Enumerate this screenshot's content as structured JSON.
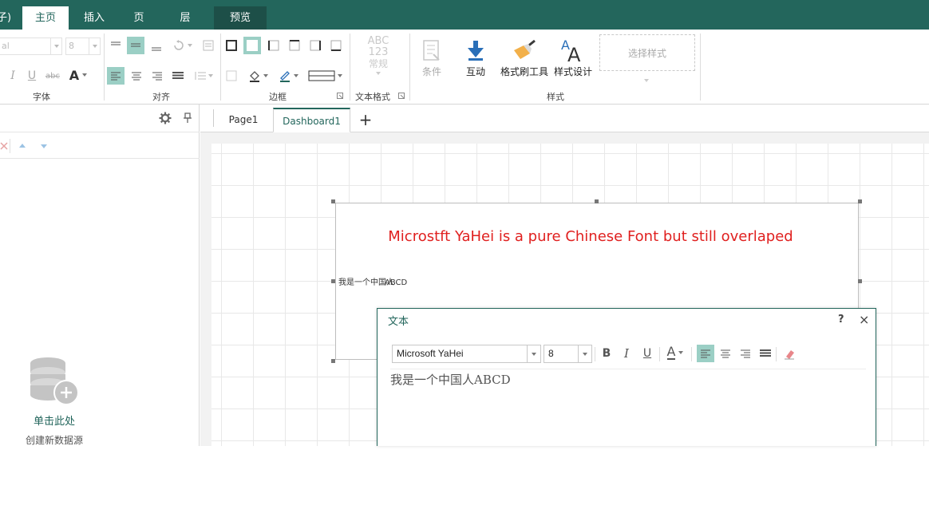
{
  "colors": {
    "brand": "#23665c",
    "selected": "#9bcfc5",
    "title_red": "#e0201f"
  },
  "menubar": {
    "partial_left": "子)",
    "tabs": [
      {
        "label": "主页",
        "active": true
      },
      {
        "label": "插入"
      },
      {
        "label": "页"
      },
      {
        "label": "层"
      },
      {
        "label": "预览"
      }
    ]
  },
  "ribbon": {
    "font_name_partial": "al",
    "font_size": "8",
    "groups": {
      "font": "字体",
      "align": "对齐",
      "border": "边框",
      "text_format": "文本格式",
      "style": "样式"
    },
    "text_format_preview": {
      "line1": "ABC",
      "line2": "123",
      "line3": "常规"
    },
    "buttons": {
      "condition": "条件",
      "interact": "互动",
      "format_painter": "格式刷工具",
      "style_design": "样式设计"
    },
    "style_select_placeholder": "选择样式",
    "icons": [
      "italic-icon",
      "underline-icon",
      "strikethrough-icon",
      "font-color-icon",
      "align-left-icon",
      "align-center-icon",
      "align-right-icon",
      "justify-icon",
      "rotate-icon",
      "border-outer-icon",
      "fill-color-icon",
      "line-color-icon",
      "line-style-icon",
      "condition-icon",
      "interact-icon",
      "format-painter-icon",
      "style-design-icon"
    ]
  },
  "left_panel": {
    "datasource_link": "单击此处",
    "datasource_sub": "创建新数据源",
    "icons": [
      "gear-icon",
      "pin-icon",
      "delete-icon",
      "move-up-icon",
      "move-down-icon",
      "database-add-icon"
    ]
  },
  "tabs": {
    "pages": [
      {
        "label": "Page1"
      },
      {
        "label": "Dashboard1",
        "active": true
      }
    ],
    "add": "+"
  },
  "widget": {
    "title": "Microstft YaHei is a pure Chinese Font but still overlaped",
    "content_chinese": "我是一个中国人",
    "content_latin": "ABCD"
  },
  "dialog": {
    "title": "文本",
    "help": "?",
    "close": "×",
    "font_name": "Microsoft YaHei",
    "font_size": "8",
    "bold": "B",
    "italic": "I",
    "underline": "U",
    "font_color": "A",
    "editor_text": "我是一个中国人ABCD"
  }
}
